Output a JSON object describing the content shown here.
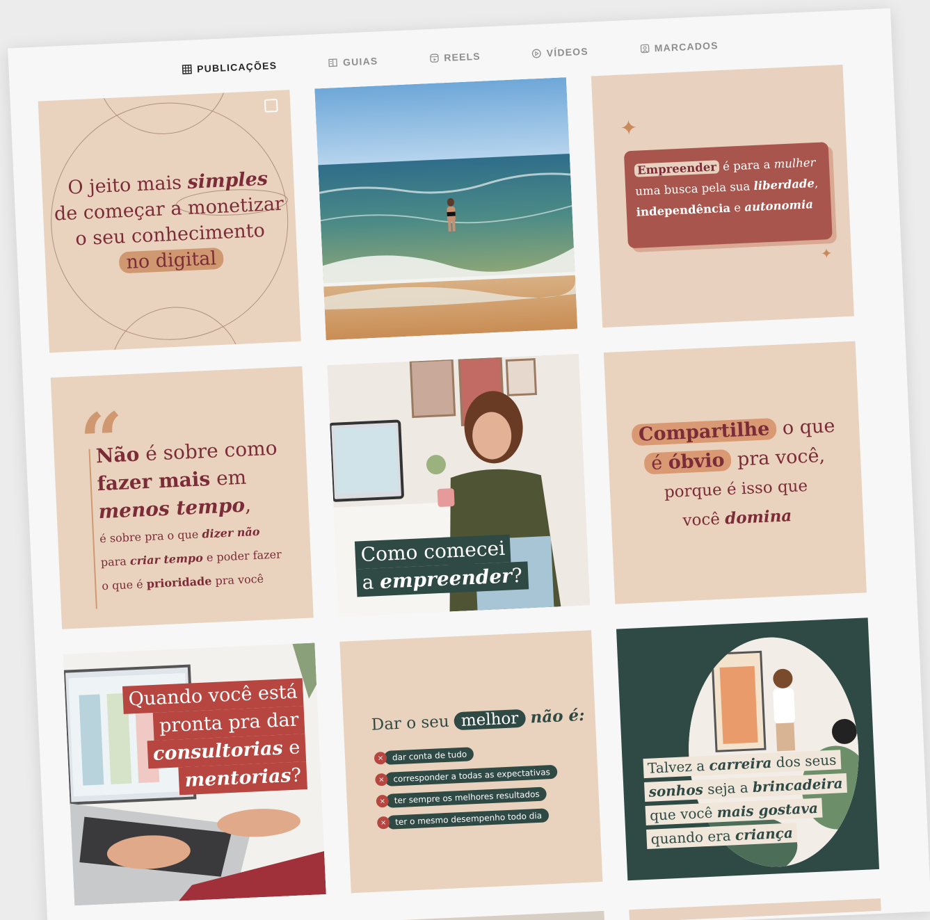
{
  "tabs": [
    {
      "label": "PUBLICAÇÕES",
      "icon": "grid-icon",
      "active": true
    },
    {
      "label": "GUIAS",
      "icon": "guide-icon",
      "active": false
    },
    {
      "label": "REELS",
      "icon": "reels-icon",
      "active": false
    },
    {
      "label": "VÍDEOS",
      "icon": "play-icon",
      "active": false
    },
    {
      "label": "MARCADOS",
      "icon": "tagged-icon",
      "active": false
    }
  ],
  "posts": {
    "p1": {
      "l1a": "O jeito mais ",
      "l1b": "simples",
      "l2": "de começar a monetizar",
      "l3": "o seu conhecimento",
      "l4": "no digital"
    },
    "p2": {
      "alt": ""
    },
    "p3": {
      "w1": "Empreender",
      "w2": " é para a ",
      "w3": "mulher",
      "w4": "uma busca pela sua ",
      "w5": "liberdade",
      "w6": ",",
      "w7": "independência",
      "w8": " e ",
      "w9": "autonomia"
    },
    "p4": {
      "a1": "Não",
      "a2": " é sobre como",
      "b1": "fazer mais",
      "b2": " em",
      "c1": "menos tempo",
      "c2": ",",
      "d1": "é sobre pra o que ",
      "d2": "dizer não",
      "e1": "para ",
      "e2": "criar tempo",
      "e3": " e poder fazer",
      "f1": "o que é ",
      "f2": "prioridade",
      "f3": " pra você"
    },
    "p5": {
      "l1": "Como comecei",
      "l2a": "a ",
      "l2b": "empreender",
      "l2c": "?"
    },
    "p6": {
      "a1": "Compartilhe",
      "a2": " o que",
      "b1": "é ",
      "b2": "óbvio",
      "b3": " pra você,",
      "c1": "porque é isso que",
      "d1": "você ",
      "d2": "domina"
    },
    "p7": {
      "l1": "Quando você está",
      "l2": "pronta pra dar",
      "l3a": "consultorias",
      "l3b": " e",
      "l4a": "mentorias",
      "l4b": "?"
    },
    "p8": {
      "t1": "Dar o seu",
      "t2": "melhor",
      "t3": "não é:",
      "items": [
        "dar conta de tudo",
        "corresponder a todas as expectativas",
        "ter sempre os melhores resultados",
        "ter o mesmo desempenho todo dia"
      ],
      "x": "×"
    },
    "p9": {
      "l1a": "Talvez a ",
      "l1b": "carreira",
      "l1c": " dos seus",
      "l2a": "sonhos",
      "l2b": " seja a ",
      "l2c": "brincadeira",
      "l3a": "que você ",
      "l3b": "mais gostava",
      "l4a": "quando era ",
      "l4b": "criança"
    }
  },
  "colors": {
    "beige": "#ead3be",
    "rose": "#7b2c38",
    "accent": "#cf9870",
    "green": "#2f4a45",
    "terracotta": "#a8564d"
  }
}
